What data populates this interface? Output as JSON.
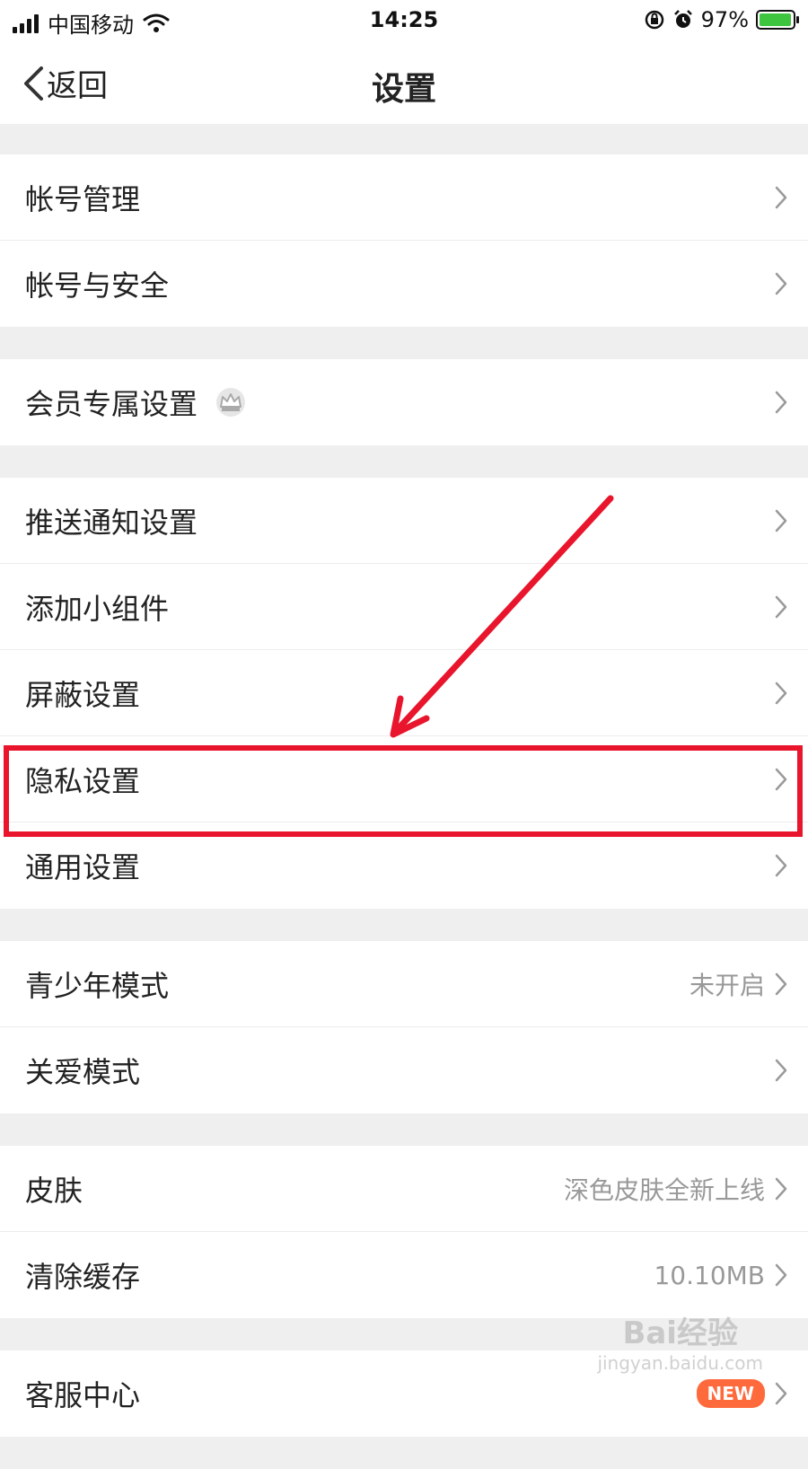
{
  "status_bar": {
    "carrier": "中国移动",
    "time": "14:25",
    "battery_text": "97%",
    "battery_level": 0.97,
    "icons": [
      "signal-icon",
      "wifi-icon",
      "rotation-lock-icon",
      "alarm-icon",
      "battery-icon"
    ]
  },
  "nav": {
    "back_label": "返回",
    "title": "设置"
  },
  "groups": [
    {
      "items": [
        {
          "label": "帐号管理"
        },
        {
          "label": "帐号与安全"
        }
      ]
    },
    {
      "items": [
        {
          "label": "会员专属设置",
          "icon": "crown-icon"
        }
      ]
    },
    {
      "items": [
        {
          "label": "推送通知设置"
        },
        {
          "label": "添加小组件"
        },
        {
          "label": "屏蔽设置"
        },
        {
          "label": "隐私设置",
          "highlighted": true
        },
        {
          "label": "通用设置"
        }
      ]
    },
    {
      "items": [
        {
          "label": "青少年模式",
          "value": "未开启"
        },
        {
          "label": "关爱模式"
        }
      ]
    },
    {
      "items": [
        {
          "label": "皮肤",
          "value": "深色皮肤全新上线"
        },
        {
          "label": "清除缓存",
          "value": "10.10MB"
        }
      ]
    },
    {
      "items": [
        {
          "label": "客服中心",
          "badge": "NEW"
        }
      ]
    }
  ],
  "annotation": {
    "color": "#e8152c"
  },
  "watermark": {
    "main": "Bai经验",
    "sub": "jingyan.baidu.com"
  }
}
